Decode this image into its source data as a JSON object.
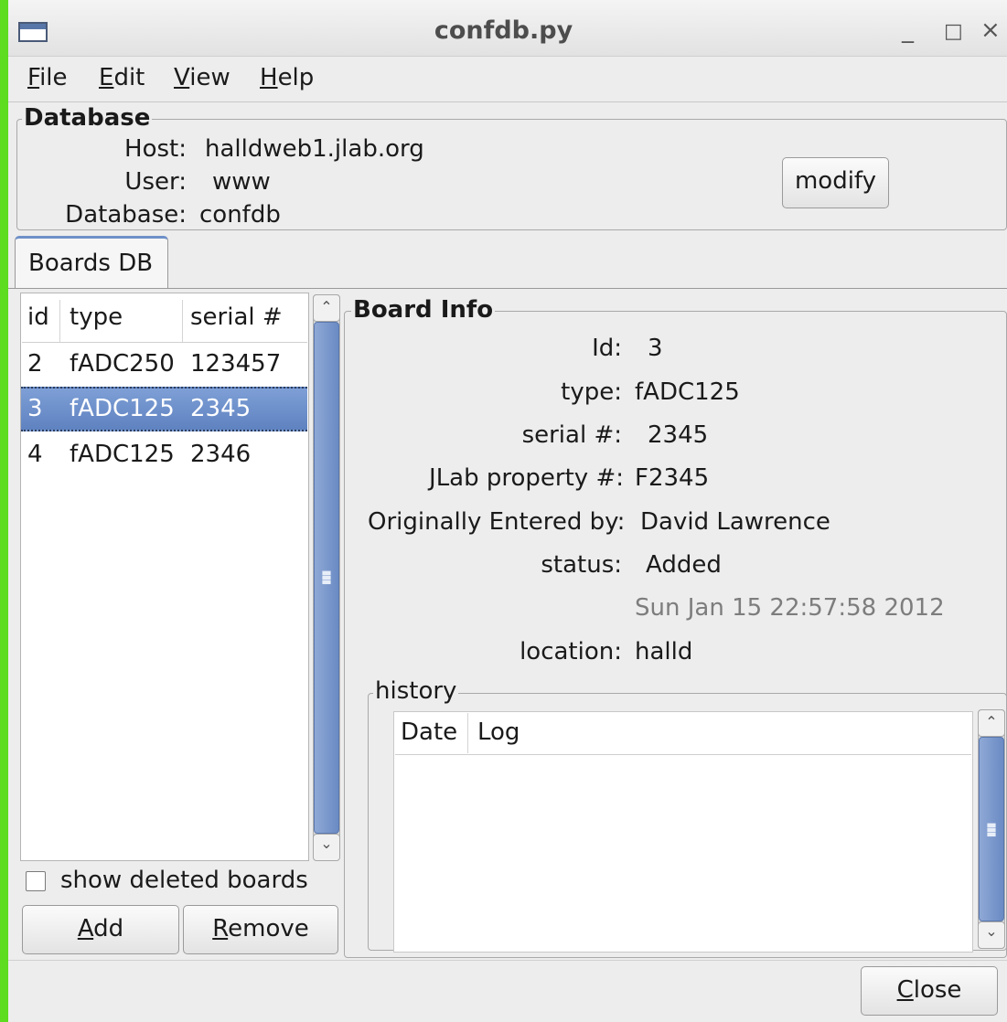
{
  "window": {
    "title": "confdb.py",
    "minimize_label": "_",
    "maximize_label": "□",
    "close_label": "×"
  },
  "menu": [
    {
      "label": "File",
      "mnemonic": "F",
      "rest": "ile"
    },
    {
      "label": "Edit",
      "mnemonic": "E",
      "rest": "dit"
    },
    {
      "label": "View",
      "mnemonic": "V",
      "rest": "iew"
    },
    {
      "label": "Help",
      "mnemonic": "H",
      "rest": "elp"
    }
  ],
  "database": {
    "frame_title": "Database",
    "host_label": "Host:",
    "host_value": "halldweb1.jlab.org",
    "user_label": "User:",
    "user_value": "www",
    "db_label": "Database:",
    "db_value": "confdb",
    "modify_label": "modify"
  },
  "tabs": [
    {
      "label": "Boards DB"
    }
  ],
  "boards": {
    "columns": [
      "id",
      "type",
      "serial #"
    ],
    "rows": [
      {
        "id": "2",
        "type": "fADC250",
        "serial": "123457"
      },
      {
        "id": "3",
        "type": "fADC125",
        "serial": "2345"
      },
      {
        "id": "4",
        "type": "fADC125",
        "serial": "2346"
      }
    ],
    "selected_index": 1,
    "show_deleted_label": "show deleted boards",
    "add_mnemonic": "A",
    "add_rest": "dd",
    "remove_mnemonic": "R",
    "remove_rest": "emove"
  },
  "board_info": {
    "frame_title": "Board Info",
    "id_label": "Id:",
    "id_value": "3",
    "type_label": "type:",
    "type_value": "fADC125",
    "serial_label": "serial #:",
    "serial_value": "2345",
    "property_label": "JLab property #:",
    "property_value": "F2345",
    "entered_label": "Originally Entered by:",
    "entered_value": "David Lawrence",
    "status_label": "status:",
    "status_value": "Added",
    "status_time": "Sun Jan 15 22:57:58 2012",
    "location_label": "location:",
    "location_value": "halld"
  },
  "history": {
    "frame_title": "history",
    "columns": [
      "Date",
      "Log"
    ]
  },
  "footer": {
    "close_mnemonic": "C",
    "close_rest": "lose"
  },
  "colors": {
    "selection": "#6e8fc9",
    "scroll_thumb": "#7b98cc",
    "focus_edge": "#5edc1f"
  },
  "icons": [
    "window-menu-icon",
    "scroll-up-icon",
    "scroll-down-icon",
    "scroll-grip-icon"
  ]
}
